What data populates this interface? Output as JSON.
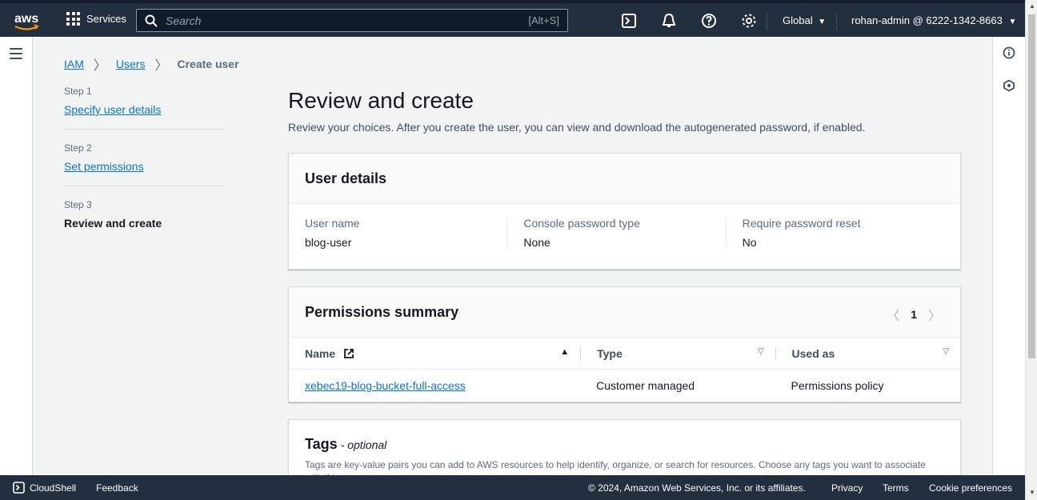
{
  "nav": {
    "logo_text": "aws",
    "services_label": "Services",
    "search_placeholder": "Search",
    "search_shortcut": "[Alt+S]",
    "region_label": "Global",
    "account_label": "rohan-admin @ 6222-1342-8663"
  },
  "breadcrumb": {
    "items": [
      "IAM",
      "Users"
    ],
    "current": "Create user"
  },
  "steps": [
    {
      "num": "Step 1",
      "label": "Specify user details"
    },
    {
      "num": "Step 2",
      "label": "Set permissions"
    },
    {
      "num": "Step 3",
      "label": "Review and create"
    }
  ],
  "page": {
    "title": "Review and create",
    "description": "Review your choices. After you create the user, you can view and download the autogenerated password, if enabled."
  },
  "user_details": {
    "title": "User details",
    "fields": [
      {
        "label": "User name",
        "value": "blog-user"
      },
      {
        "label": "Console password type",
        "value": "None"
      },
      {
        "label": "Require password reset",
        "value": "No"
      }
    ]
  },
  "permissions": {
    "title": "Permissions summary",
    "page": "1",
    "columns": [
      "Name",
      "Type",
      "Used as"
    ],
    "rows": [
      {
        "name": "xebec19-blog-bucket-full-access",
        "type": "Customer managed",
        "used_as": "Permissions policy"
      }
    ]
  },
  "tags": {
    "title": "Tags",
    "optional": "- optional",
    "description": "Tags are key-value pairs you can add to AWS resources to help identify, organize, or search for resources. Choose any tags you want to associate with this user."
  },
  "footer": {
    "cloudshell": "CloudShell",
    "feedback": "Feedback",
    "copyright": "© 2024, Amazon Web Services, Inc. or its affiliates.",
    "privacy": "Privacy",
    "terms": "Terms",
    "cookie": "Cookie preferences"
  },
  "colors": {
    "nav_bg": "#232f3e",
    "link": "#0972d3",
    "page_bg": "#f2f3f3"
  }
}
